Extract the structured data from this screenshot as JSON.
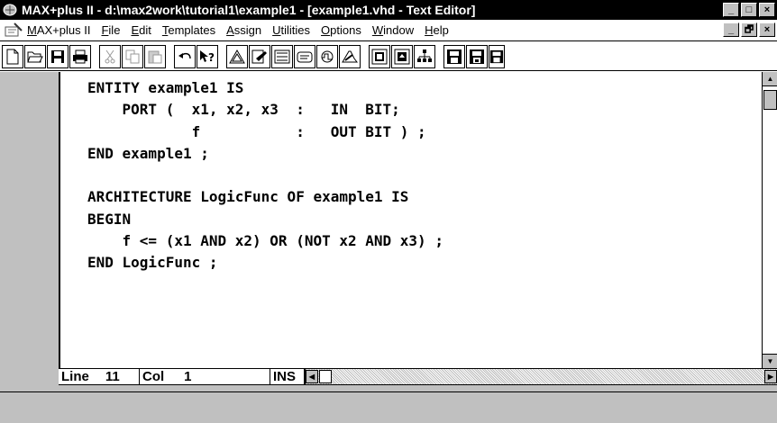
{
  "window": {
    "title": "MAX+plus II - d:\\max2work\\tutorial1\\example1 - [example1.vhd - Text Editor]",
    "controls": [
      "_",
      "□",
      "×"
    ]
  },
  "menu": {
    "items": [
      "MAX+plus II",
      "File",
      "Edit",
      "Templates",
      "Assign",
      "Utilities",
      "Options",
      "Window",
      "Help"
    ],
    "underlines": [
      "M",
      "F",
      "E",
      "T",
      "A",
      "U",
      "O",
      "W",
      "H"
    ],
    "mdi_controls": [
      "_",
      "🗗",
      "×"
    ]
  },
  "toolbar": {
    "buttons": [
      "new-icon",
      "open-icon",
      "save-icon",
      "print-icon",
      "cut-icon",
      "copy-icon",
      "paste-icon",
      "undo-icon",
      "context-help-icon",
      "hierarchy-icon",
      "graphic-editor-icon",
      "symbol-editor-icon",
      "text-editor-icon",
      "waveform-editor-icon",
      "floorplan-editor-icon",
      "compiler-icon",
      "simulator-icon",
      "timing-analyzer-icon",
      "save-check-icon",
      "save-compile-icon",
      "save-simulate-icon"
    ]
  },
  "editor": {
    "lines": [
      "ENTITY example1 IS",
      "    PORT (  x1, x2, x3  :   IN  BIT;",
      "            f           :   OUT BIT ) ;",
      "END example1 ;",
      "",
      "ARCHITECTURE LogicFunc OF example1 IS",
      "BEGIN",
      "    f <= (x1 AND x2) OR (NOT x2 AND x3) ;",
      "END LogicFunc ;"
    ]
  },
  "status": {
    "line_label": "Line",
    "line_value": "11",
    "col_label": "Col",
    "col_value": "1",
    "mode": "INS"
  }
}
